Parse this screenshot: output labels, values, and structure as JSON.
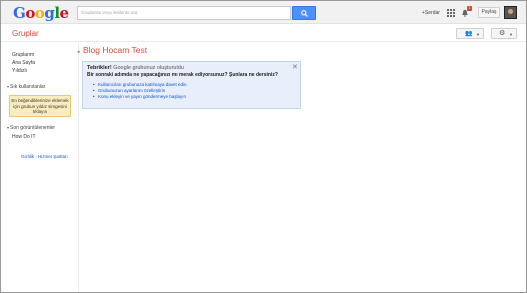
{
  "logo": [
    "G",
    "o",
    "o",
    "g",
    "l",
    "e"
  ],
  "logo_colors": [
    "#3369e8",
    "#d50f25",
    "#eeb211",
    "#3369e8",
    "#009925",
    "#d50f25"
  ],
  "search": {
    "placeholder": "Gruplarda veya iletilerde ara"
  },
  "header": {
    "user_link": "+Serdar",
    "notification_count": "1",
    "share_label": "Paylaş"
  },
  "app_title": "Gruplar",
  "sidebar": {
    "items": [
      "Gruplarım",
      "Ana Sayfa",
      "Yıldızlı"
    ],
    "favorites_heading": "Sık kullanılanlar",
    "favorites_note": "En beğendiklerinize eklemek için grubun yıldız simgesini tıklayın",
    "recent_heading": "Son görüntülenenler",
    "recent_items": [
      "How Do IT"
    ],
    "footer_link": "Gizlilik - Hizmet Şartları"
  },
  "main": {
    "group_title": "Blog Hocam Test",
    "welcome": {
      "congrats": "Tebrikler!",
      "created": "Google grubunuz oluşturuldu",
      "question": "Bir sonraki adımda ne yapacağınızı mı merak ediyorsunuz? Şunlara ne dersiniz?",
      "links": [
        "Kullanıcıları grubunuza katılmaya davet edin",
        "Grubunuzun ayarlarını özelleştirin",
        "Konu ekleyin ve yayın göndermeye başlayın"
      ]
    }
  },
  "colors": {
    "accent": "#dd4b39",
    "link": "#1155cc",
    "search_button": "#4d90fe"
  }
}
